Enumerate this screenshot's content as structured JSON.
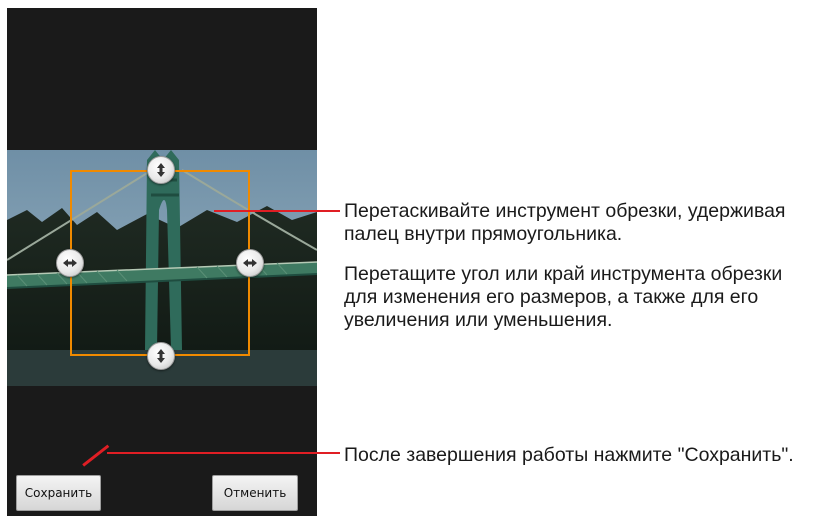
{
  "screen": {
    "buttons": {
      "save_label": "Сохранить",
      "cancel_label": "Отменить"
    },
    "handles": [
      "resize-vertical-icon",
      "resize-horizontal-icon",
      "resize-horizontal-icon",
      "resize-vertical-icon"
    ]
  },
  "callouts": {
    "move_crop": "Перетаскивайте инструмент обрезки, удерживая палец внутри прямоугольника.",
    "resize_crop": "Перетащите угол или край инструмента обрезки для изменения его размеров, а также для его увеличения или уменьшения.",
    "save_hint": "После завершения работы нажмите \"Сохранить\"."
  },
  "colors": {
    "crop_border": "#f08a00",
    "leader_line": "#e01e24",
    "screen_background": "#1a1a1a"
  }
}
